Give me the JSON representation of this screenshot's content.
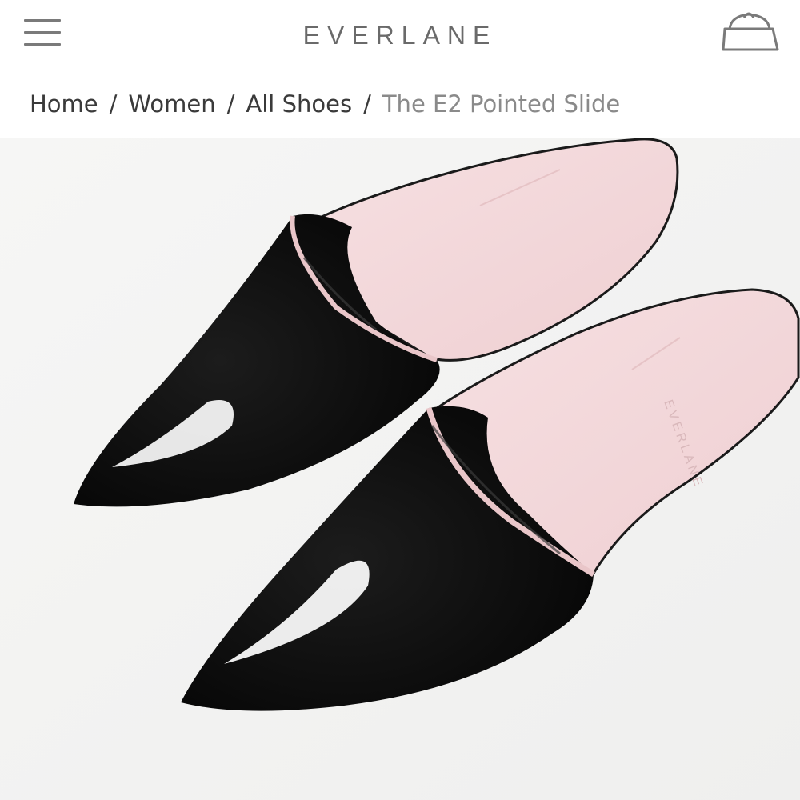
{
  "header": {
    "logo": "EVERLANE",
    "menu_icon": "hamburger-menu-icon",
    "cart_icon": "shopping-bag-icon"
  },
  "breadcrumb": {
    "items": [
      "Home",
      "Women",
      "All Shoes"
    ],
    "separator": "/",
    "current": "The E2 Pointed Slide"
  },
  "product": {
    "image_label": "EVERLANE",
    "colors": {
      "shoe": "#0b0b0b",
      "lining": "#f2d6d8",
      "background": "#f4f4f3"
    }
  }
}
